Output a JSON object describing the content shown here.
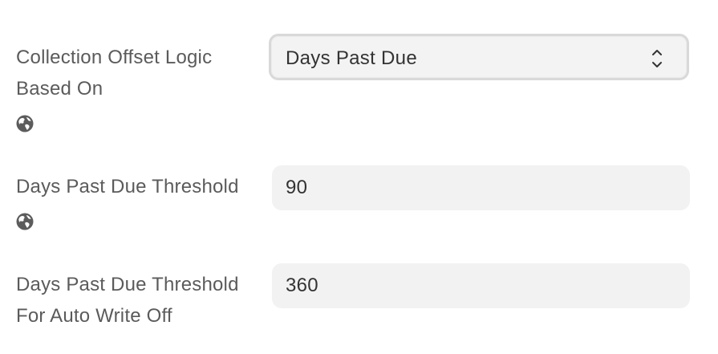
{
  "fields": [
    {
      "label_line1": "Collection Offset Logic",
      "label_line2": "Based On",
      "icon": "globe-icon",
      "control": "select",
      "value": "Days Past Due"
    },
    {
      "label_line1": "Days Past Due Threshold",
      "icon": "globe-icon",
      "control": "input",
      "value": "90"
    },
    {
      "label_line1": "Days Past Due Threshold",
      "label_line2": "For Auto Write Off",
      "control": "input",
      "value": "360"
    }
  ]
}
